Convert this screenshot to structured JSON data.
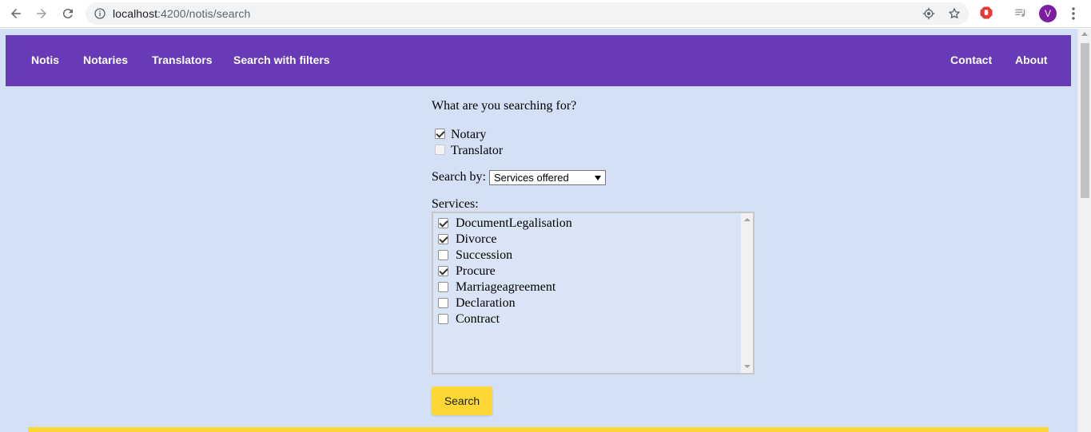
{
  "browser": {
    "url_host": "localhost",
    "url_port_path": ":4200/notis/search",
    "avatar_initial": "V",
    "icons": [
      "back-icon",
      "forward-icon",
      "reload-icon",
      "info-icon",
      "location-icon",
      "star-icon",
      "adblock-icon",
      "media-icon",
      "menu-icon"
    ]
  },
  "navbar": {
    "background": "#673ab7",
    "left_links": [
      "Notis",
      "Notaries",
      "Translators",
      "Search with filters"
    ],
    "right_links": [
      "Contact",
      "About"
    ]
  },
  "form": {
    "question": "What are you searching for?",
    "type_options": [
      {
        "label": "Notary",
        "checked": true
      },
      {
        "label": "Translator",
        "checked": false
      }
    ],
    "search_by_label": "Search by:",
    "search_by_value": "Services offered",
    "services_label": "Services:",
    "services": [
      {
        "label": "DocumentLegalisation",
        "checked": true
      },
      {
        "label": "Divorce",
        "checked": true
      },
      {
        "label": "Succession",
        "checked": false
      },
      {
        "label": "Procure",
        "checked": true
      },
      {
        "label": "Marriageagreement",
        "checked": false
      },
      {
        "label": "Declaration",
        "checked": false
      },
      {
        "label": "Contract",
        "checked": false
      }
    ],
    "search_button": "Search",
    "accent": "#fdd835"
  }
}
